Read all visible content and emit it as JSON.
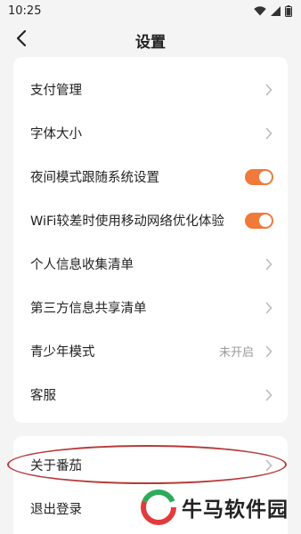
{
  "status_bar": {
    "time": "10:25",
    "icons": [
      "wifi-icon",
      "signal-icon",
      "battery-icon"
    ]
  },
  "nav": {
    "title": "设置",
    "back_icon": "back-arrow-icon"
  },
  "settings": {
    "items": [
      {
        "label": "支付管理",
        "control": "chevron"
      },
      {
        "label": "字体大小",
        "control": "chevron"
      },
      {
        "label": "夜间模式跟随系统设置",
        "control": "toggle",
        "on": true
      },
      {
        "label": "WiFi较差时使用移动网络优化体验",
        "control": "toggle",
        "on": true
      },
      {
        "label": "个人信息收集清单",
        "control": "chevron"
      },
      {
        "label": "第三方信息共享清单",
        "control": "chevron"
      },
      {
        "label": "青少年模式",
        "value": "未开启",
        "control": "chevron"
      },
      {
        "label": "客服",
        "control": "chevron"
      }
    ]
  },
  "bottom": {
    "items": [
      {
        "label": "关于番茄",
        "control": "chevron"
      },
      {
        "label": "退出登录"
      }
    ]
  },
  "watermark": {
    "text": "牛马软件园"
  },
  "colors": {
    "accent": "#ef7a3a",
    "background": "#f4f4f4",
    "highlight": "#b73a3a"
  }
}
